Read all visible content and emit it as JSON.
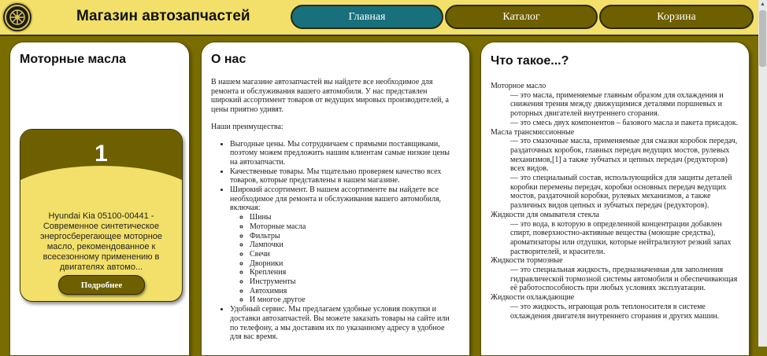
{
  "header": {
    "title": "Магазин автозапчастей",
    "nav": [
      "Главная",
      "Каталог",
      "Корзина"
    ]
  },
  "oils": {
    "heading": "Моторные масла",
    "card": {
      "number": "1",
      "description": "Hyundai Kia 05100-00441 - Современное синтетическое энергосберегающее моторное масло, рекомендованное к всесезонному применению в двигателях автомо...",
      "button": "Подробнее"
    }
  },
  "about": {
    "heading": "О нас",
    "intro": "В нашем магазине автозапчастей вы найдете все необходимое для ремонта и обслуживания вашего автомобиля. У нас представлен широкий ассортимент товаров от ведущих мировых производителей, а цены приятно удивят.",
    "advantages_title": "Наши преимущества:",
    "advantages": [
      "Выгодные цены. Мы сотрудничаем с прямыми поставщиками, поэтому можем предложить нашим клиентам самые низкие цены на автозапчасти.",
      "Качественные товары. Мы тщательно проверяем качество всех товаров, которые представлены в нашем магазине.",
      "Широкий ассортимент. В нашем ассортименте вы найдете все необходимое для ремонта и обслуживания вашего автомобиля, включая:",
      "Удобный сервис. Мы предлагаем удобные условия покупки и доставки автозапчастей. Вы можете заказать товары на сайте или по телефону, а мы доставим их по указанному адресу в удобное для вас время."
    ],
    "assortment": [
      "Шины",
      "Моторные масла",
      "Фильтры",
      "Лампочки",
      "Свечи",
      "Дворники",
      "Крепления",
      "Инструменты",
      "Автохимия",
      "И многое другое"
    ]
  },
  "what": {
    "heading": "Что такое...?",
    "entries": [
      {
        "term": "Моторное масло",
        "defs": [
          "— это масла, применяемые главным образом для охлаждения и снижения трения между движущимися деталями поршневых и роторных двигателей внутреннего сгорания.",
          "— это смесь двух компонентов – базового масла и пакета присадок."
        ]
      },
      {
        "term": "Масла трансмиссионные",
        "defs": [
          "— это смазочные масла, применяемые для смазки коробок передач, раздаточных коробок, главных передач ведущих мостов, рулевых механизмов,[1] а также зубчатых и цепных передач (редукторов) всех видов.",
          "— это специальный состав, использующийся для защиты деталей коробки перемены передач, коробки основных передач ведущих мостов, раздаточной коробки, рулевых механизмов, а также различных видов цепных и зубчатых передач (редукторов)."
        ]
      },
      {
        "term": "Жидкости для омывателя стекла",
        "defs": [
          "— это вода, в которую в определенной концентрации добавлен спирт, поверхностно-активные вещества (моющие средства), ароматизаторы или отдушки, которые нейтрализуют резкий запах растворителей, и красители."
        ]
      },
      {
        "term": "Жидкости тормозные",
        "defs": [
          "— это специальная жидкость, предназначенная для заполнения гидравлической тормозной системы автомобиля и обеспечивающая её работоспособность при любых условиях эксплуатации."
        ]
      },
      {
        "term": "Жидкости охлаждающие",
        "defs": [
          "— это жидкость, играющая роль теплоносителя в системе охлаждения двигателя внутреннего сгорания и других машин."
        ]
      }
    ]
  },
  "colors": {
    "accent_yellow": "#f2e06a",
    "olive": "#6e5f00",
    "teal_active": "#17707c"
  }
}
